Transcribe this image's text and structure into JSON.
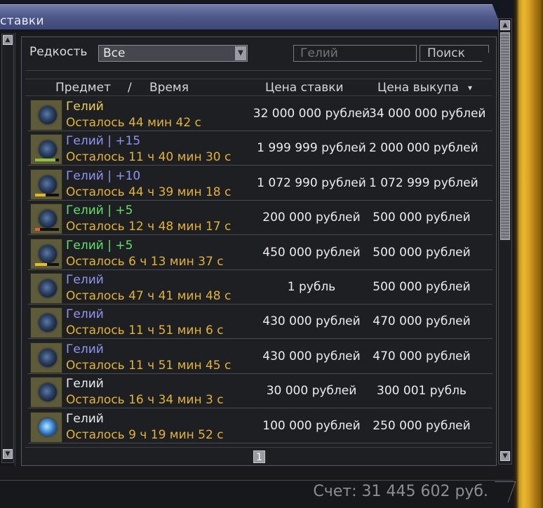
{
  "window": {
    "title": "ставки"
  },
  "filter": {
    "rarity_label": "Редкость",
    "rarity_value": "Все",
    "search_placeholder": "Гелий",
    "search_button": "Поиск"
  },
  "table": {
    "headers": {
      "item": "Предмет",
      "slash": "/",
      "time": "Время",
      "bid": "Цена ставки",
      "buyout": "Цена выкупа"
    },
    "sort_indicator": "▾",
    "rows": [
      {
        "name": "Гелий",
        "name_color": "#ecd24a",
        "time": "Осталось 44 мин 42 с",
        "bid": "32 000 000 рублей",
        "buyout": "34 000 000 рублей",
        "bar_color": "",
        "bar_level": 0,
        "icon": "helium-orb-icon"
      },
      {
        "name": "Гелий | +15",
        "name_color": "#8f95f0",
        "time": "Осталось 11 ч 40 мин 30 с",
        "bid": "1 999 999 рублей",
        "buyout": "2 000 000 рублей",
        "bar_color": "#8fc23a",
        "bar_level": 0.85,
        "icon": "helium-orb-icon"
      },
      {
        "name": "Гелий | +10",
        "name_color": "#8f95f0",
        "time": "Осталось 44 ч 39 мин 18 с",
        "bid": "1 072 990 рублей",
        "buyout": "1 072 999 рублей",
        "bar_color": "#e2b52a",
        "bar_level": 0.45,
        "icon": "helium-orb-icon"
      },
      {
        "name": "Гелий | +5",
        "name_color": "#62e26a",
        "time": "Осталось 12 ч 48 мин 17 с",
        "bid": "200 000 рублей",
        "buyout": "500 000 рублей",
        "bar_color": "#e2642a",
        "bar_level": 0.2,
        "icon": "helium-orb-icon"
      },
      {
        "name": "Гелий | +5",
        "name_color": "#62e26a",
        "time": "Осталось 6 ч 13 мин 37 с",
        "bid": "450 000 рублей",
        "buyout": "500 000 рублей",
        "bar_color": "#e2c02a",
        "bar_level": 0.5,
        "icon": "helium-orb-icon"
      },
      {
        "name": "Гелий",
        "name_color": "#8f95f0",
        "time": "Осталось 47 ч 41 мин 48 с",
        "bid": "1 рубль",
        "buyout": "500 000 рублей",
        "bar_color": "",
        "bar_level": 0,
        "icon": "helium-orb-icon"
      },
      {
        "name": "Гелий",
        "name_color": "#8f95f0",
        "time": "Осталось 11 ч 51 мин 6 с",
        "bid": "430 000 рублей",
        "buyout": "470 000 рублей",
        "bar_color": "",
        "bar_level": 0,
        "icon": "helium-orb-icon"
      },
      {
        "name": "Гелий",
        "name_color": "#8f95f0",
        "time": "Осталось 11 ч 51 мин 45 с",
        "bid": "430 000 рублей",
        "buyout": "470 000 рублей",
        "bar_color": "",
        "bar_level": 0,
        "icon": "helium-orb-icon"
      },
      {
        "name": "Гелий",
        "name_color": "#ececec",
        "time": "Осталось 16 ч 34 мин 3 с",
        "bid": "30 000 рублей",
        "buyout": "300 001 рубль",
        "bar_color": "",
        "bar_level": 0,
        "icon": "helium-orb-icon"
      },
      {
        "name": "Гелий",
        "name_color": "#ececec",
        "time": "Осталось 9 ч 19 мин 52 с",
        "bid": "100 000 рублей",
        "buyout": "250 000 рублей",
        "bar_color": "",
        "bar_level": 0,
        "icon": "helium-orb-bright-icon"
      }
    ]
  },
  "pagination": {
    "current_page": "1"
  },
  "footer": {
    "balance": "Счет: 31 445 602 руб."
  },
  "scroll": {
    "left_arrow_up": "▲",
    "left_arrow_down": "▼",
    "right_arrow_up": "▲",
    "right_arrow_down": "▼",
    "dropdown_arrow": "▼"
  }
}
